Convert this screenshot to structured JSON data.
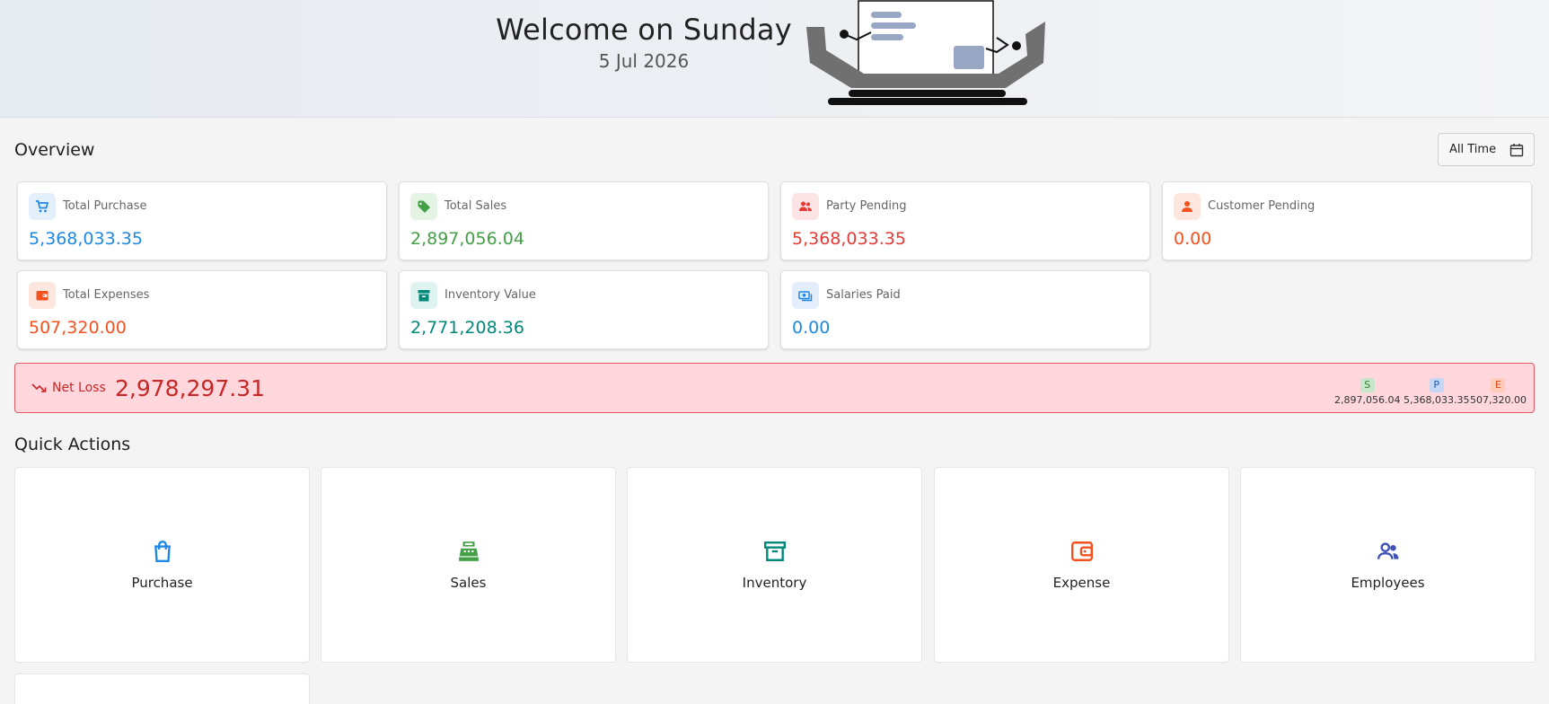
{
  "header": {
    "greeting": "Welcome on Sunday",
    "date": "5 Jul 2026"
  },
  "overview": {
    "title": "Overview",
    "range_label": "All Time",
    "cards": [
      {
        "label": "Total Purchase",
        "value": "5,368,033.35",
        "color": "#1e88e5",
        "icon": "cart-icon"
      },
      {
        "label": "Total Sales",
        "value": "2,897,056.04",
        "color": "#43a047",
        "icon": "tag-icon"
      },
      {
        "label": "Party Pending",
        "value": "5,368,033.35",
        "color": "#e53935",
        "icon": "group-icon"
      },
      {
        "label": "Customer Pending",
        "value": "0.00",
        "color": "#f4511e",
        "icon": "person-icon"
      },
      {
        "label": "Total Expenses",
        "value": "507,320.00",
        "color": "#f4511e",
        "icon": "wallet-icon"
      },
      {
        "label": "Inventory Value",
        "value": "2,771,208.36",
        "color": "#00897b",
        "icon": "archive-icon"
      },
      {
        "label": "Salaries Paid",
        "value": "0.00",
        "color": "#1e88e5",
        "icon": "payments-icon"
      }
    ]
  },
  "net": {
    "label": "Net Loss",
    "value": "2,978,297.31",
    "breakdown": [
      {
        "badge": "S",
        "value": "2,897,056.04"
      },
      {
        "badge": "P",
        "value": "5,368,033.35"
      },
      {
        "badge": "E",
        "value": "507,320.00"
      }
    ]
  },
  "quick_actions": {
    "title": "Quick Actions",
    "items": [
      {
        "label": "Purchase",
        "icon": "shopping-bag-icon",
        "color": "#1e88e5"
      },
      {
        "label": "Sales",
        "icon": "cash-register-icon",
        "color": "#43a047"
      },
      {
        "label": "Inventory",
        "icon": "archive-icon",
        "color": "#00897b"
      },
      {
        "label": "Expense",
        "icon": "wallet-icon",
        "color": "#f4511e"
      },
      {
        "label": "Employees",
        "icon": "people-icon",
        "color": "#3f51b5"
      }
    ]
  }
}
